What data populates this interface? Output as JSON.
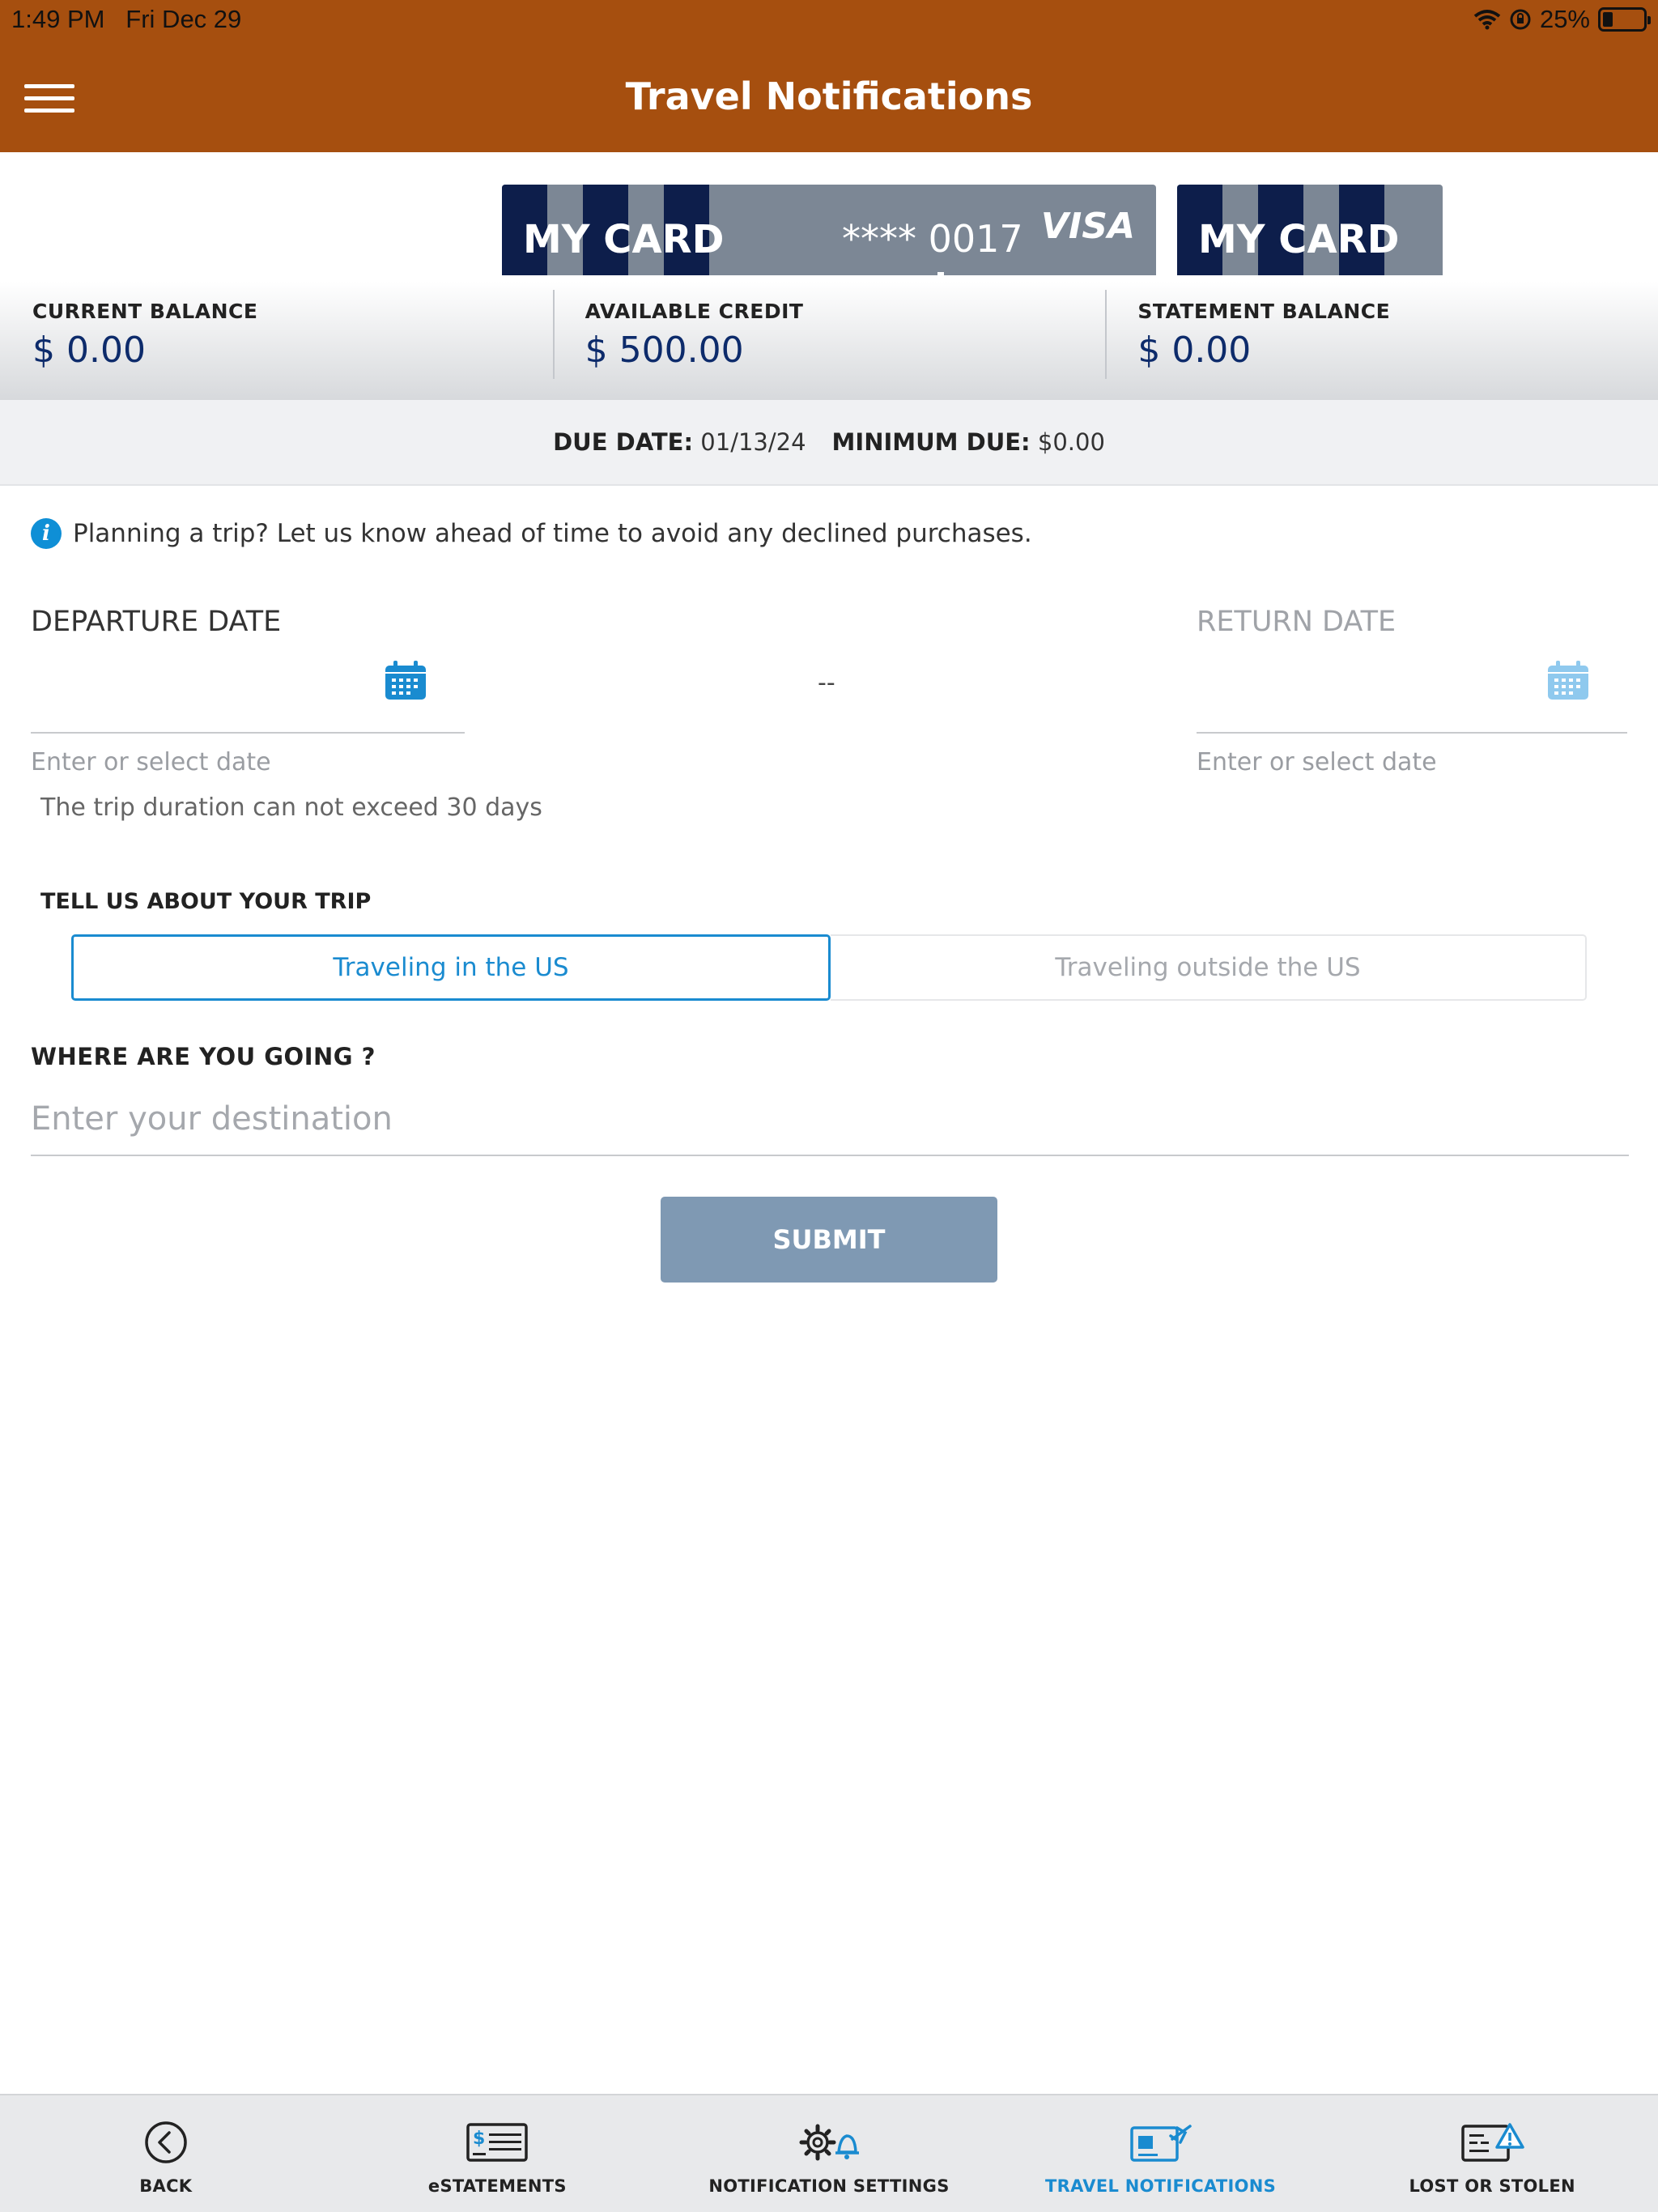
{
  "status_bar": {
    "time": "1:49 PM",
    "date": "Fri Dec 29",
    "battery": "25%"
  },
  "header": {
    "title": "Travel Notifications"
  },
  "cards": [
    {
      "label": "MY CARD",
      "number": "**** 0017",
      "brand": "VISA"
    },
    {
      "label": "MY CARD"
    }
  ],
  "balances": [
    {
      "label": "CURRENT BALANCE",
      "value": "$ 0.00"
    },
    {
      "label": "AVAILABLE CREDIT",
      "value": "$ 500.00"
    },
    {
      "label": "STATEMENT BALANCE",
      "value": "$ 0.00"
    }
  ],
  "due": {
    "due_label": "DUE DATE:",
    "due_value": "01/13/24",
    "min_label": "MINIMUM DUE:",
    "min_value": "$0.00"
  },
  "info": {
    "message": "Planning a trip? Let us know ahead of time to avoid any declined purchases."
  },
  "dates": {
    "departure_label": "DEPARTURE DATE",
    "return_label": "RETURN DATE",
    "hint": "Enter or select date",
    "separator": "--",
    "duration_note": "The trip duration can not exceed 30 days"
  },
  "trip": {
    "label": "TELL US ABOUT YOUR TRIP",
    "options": [
      "Traveling in the US",
      "Traveling outside the US"
    ],
    "selected": "Traveling in the US"
  },
  "destination": {
    "label": "WHERE ARE YOU GOING ?",
    "placeholder": "Enter your destination",
    "value": ""
  },
  "submit": {
    "label": "SUBMIT"
  },
  "tabbar": {
    "items": [
      {
        "label": "BACK",
        "icon": "back-icon"
      },
      {
        "label": "eSTATEMENTS",
        "icon": "statement-icon"
      },
      {
        "label": "NOTIFICATION SETTINGS",
        "icon": "gear-bell-icon"
      },
      {
        "label": "TRAVEL NOTIFICATIONS",
        "icon": "card-plane-icon"
      },
      {
        "label": "LOST OR STOLEN",
        "icon": "card-warning-icon"
      }
    ],
    "active": "TRAVEL NOTIFICATIONS"
  },
  "colors": {
    "header": "#a64f0f",
    "accent": "#1a8bd0",
    "card_navy": "#0d1e4b",
    "submit": "#7f99b3"
  }
}
